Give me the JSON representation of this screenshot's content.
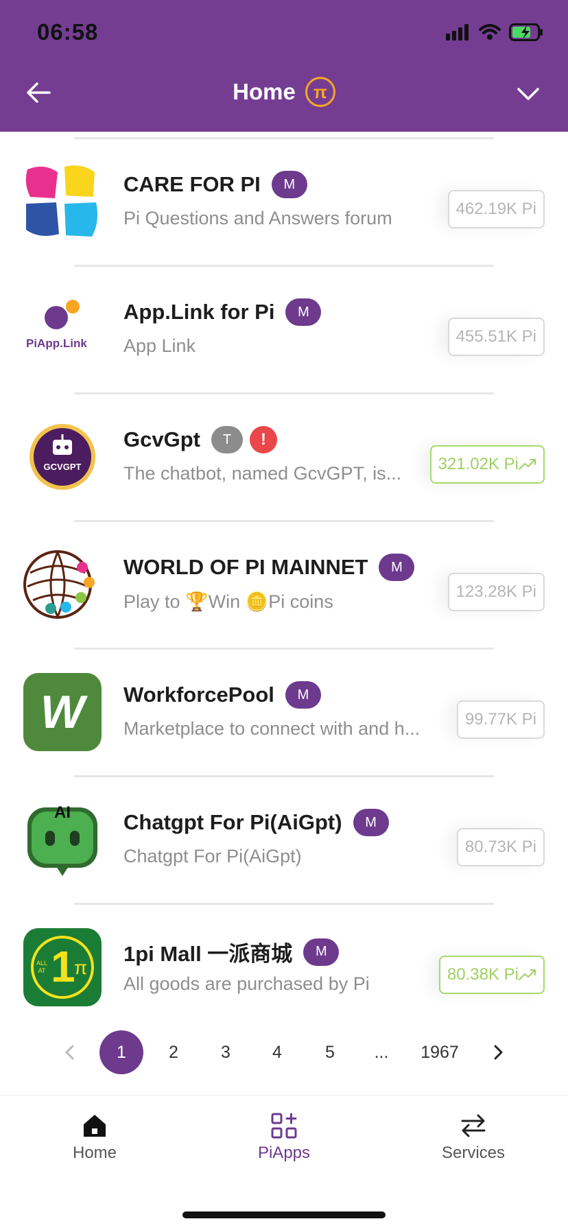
{
  "status_bar": {
    "time": "06:58"
  },
  "header": {
    "title": "Home",
    "logo_glyph": "π"
  },
  "apps": [
    {
      "name": "CARE FOR PI",
      "badges": [
        "M"
      ],
      "description": "Pi Questions and Answers forum",
      "stake": "462.19K Pi",
      "trending": false,
      "icon": "care-for-pi-logo"
    },
    {
      "name": "App.Link for Pi",
      "badges": [
        "M"
      ],
      "description": "App Link",
      "stake": "455.51K Pi",
      "trending": false,
      "icon": "piapp-link-logo",
      "icon_text": "PiApp.Link"
    },
    {
      "name": "GcvGpt",
      "badges": [
        "T",
        "!"
      ],
      "description": "The chatbot, named GcvGPT, is...",
      "stake": "321.02K Pi",
      "trending": true,
      "icon": "gcvgpt-logo",
      "icon_text": "GCVGPT"
    },
    {
      "name": "WORLD OF PI MAINNET",
      "badges": [
        "M"
      ],
      "description": "Play to 🏆Win 🪙Pi coins",
      "stake": "123.28K Pi",
      "trending": false,
      "icon": "world-of-pi-logo"
    },
    {
      "name": "WorkforcePool",
      "badges": [
        "M"
      ],
      "description": "Marketplace to connect with and h...",
      "stake": "99.77K Pi",
      "trending": false,
      "icon": "workforcepool-logo",
      "icon_text": "W"
    },
    {
      "name": "Chatgpt For Pi(AiGpt)",
      "badges": [
        "M"
      ],
      "description": "Chatgpt For Pi(AiGpt)",
      "stake": "80.73K Pi",
      "trending": false,
      "icon": "aigpt-logo",
      "icon_text": "AI"
    },
    {
      "name": "1pi Mall 一派商城",
      "badges": [
        "M"
      ],
      "description": "All goods are purchased by Pi",
      "stake": "80.38K Pi",
      "trending": true,
      "icon": "1pi-mall-logo",
      "icon_text": "1",
      "icon_subtext": "ALL AT",
      "icon_pi": "π"
    }
  ],
  "pagination": {
    "pages": [
      "1",
      "2",
      "3",
      "4",
      "5",
      "...",
      "1967"
    ],
    "current": "1"
  },
  "tabbar": {
    "home": "Home",
    "piapps": "PiApps",
    "services": "Services",
    "active": "PiApps"
  },
  "colors": {
    "brand": "#743d92",
    "badge": "#6d3a8e",
    "trend": "#9fd061",
    "warning": "#e9474a"
  }
}
